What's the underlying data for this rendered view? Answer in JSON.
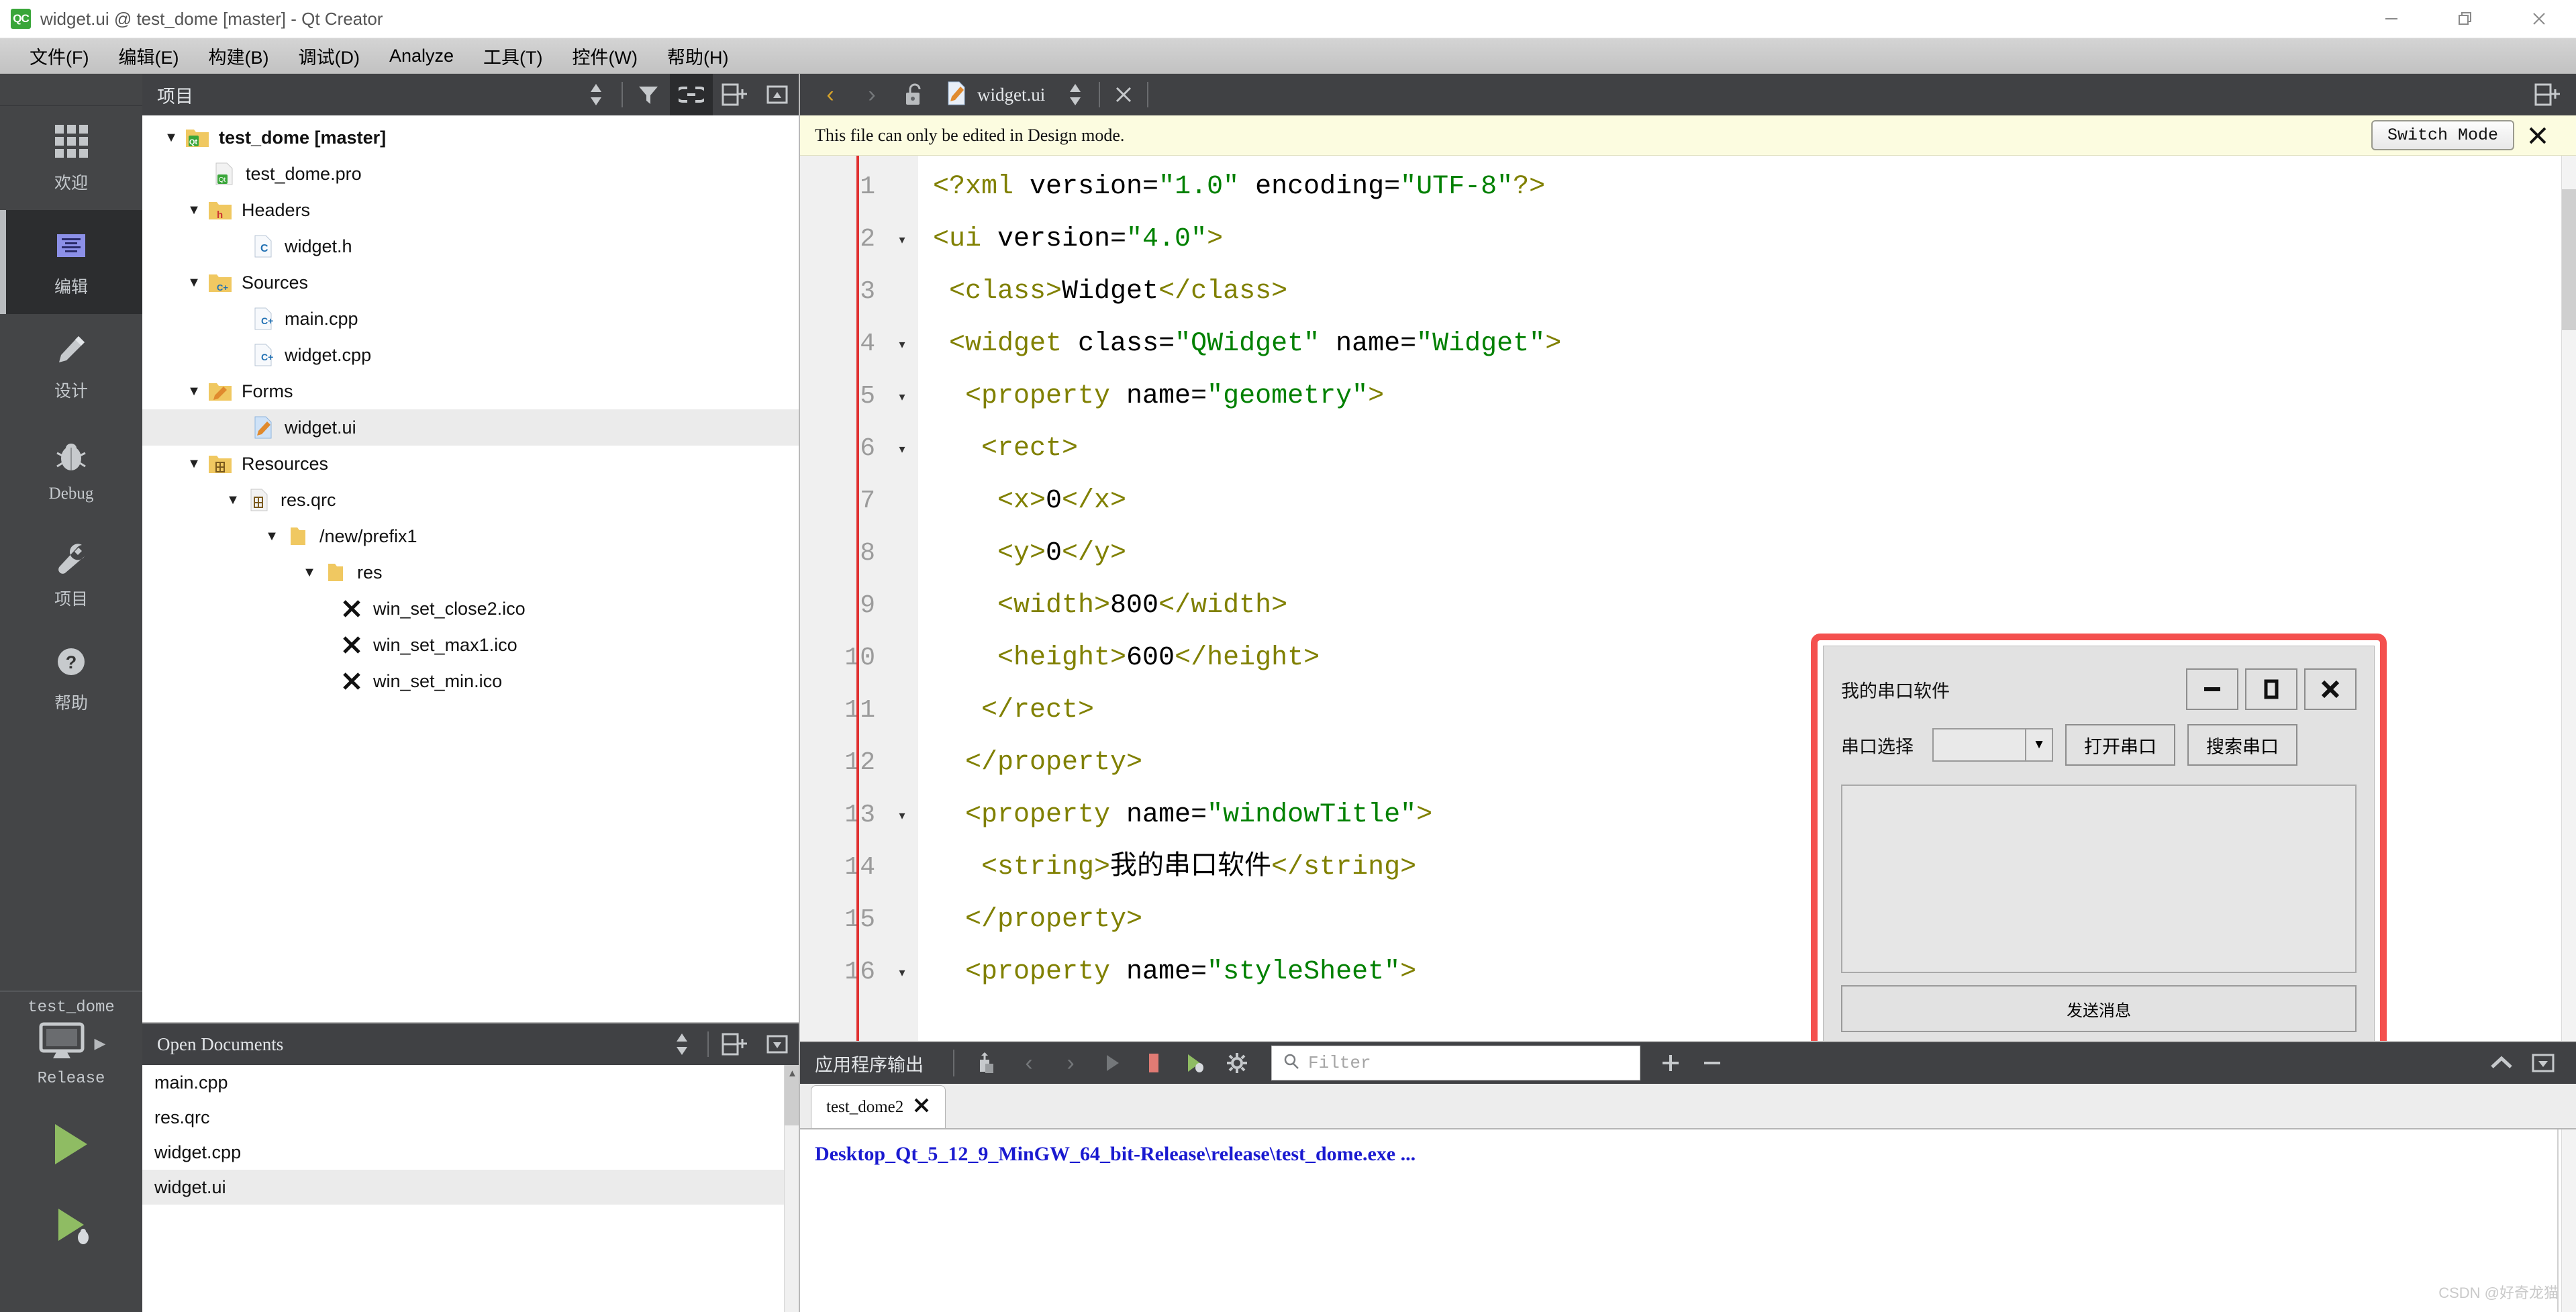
{
  "window": {
    "title": "widget.ui @ test_dome [master] - Qt Creator",
    "app_badge": "QC",
    "minimize_icon": "minimize-icon",
    "restore_icon": "restore-icon",
    "close_icon": "close-icon"
  },
  "menubar": {
    "items": [
      {
        "label": "文件(F)",
        "mnemonic": "F"
      },
      {
        "label": "编辑(E)",
        "mnemonic": "E"
      },
      {
        "label": "构建(B)",
        "mnemonic": "B"
      },
      {
        "label": "调试(D)",
        "mnemonic": "D"
      },
      {
        "label": "Analyze",
        "mnemonic": "A"
      },
      {
        "label": "工具(T)",
        "mnemonic": "T"
      },
      {
        "label": "控件(W)",
        "mnemonic": "W"
      },
      {
        "label": "帮助(H)",
        "mnemonic": "H"
      }
    ]
  },
  "modebar": {
    "items": [
      {
        "label": "欢迎",
        "icon": "grid-icon",
        "active": false
      },
      {
        "label": "编辑",
        "icon": "edit-document-icon",
        "active": true
      },
      {
        "label": "设计",
        "icon": "pencil-icon",
        "active": false
      },
      {
        "label": "Debug",
        "icon": "bug-icon",
        "active": false
      },
      {
        "label": "项目",
        "icon": "wrench-icon",
        "active": false
      },
      {
        "label": "帮助",
        "icon": "question-mark-icon",
        "active": false
      }
    ],
    "kit": {
      "project_name": "test_dome",
      "build_config": "Release",
      "target_icon": "desktop-monitor-icon",
      "run_icon": "run-play-icon",
      "debug_icon": "run-debug-icon"
    }
  },
  "project_panel": {
    "title": "项目",
    "toolbar_icons": [
      "sync-selection-icon",
      "filter-icon",
      "link-icon",
      "split-add-icon",
      "close-panel-icon"
    ],
    "tree": [
      {
        "label": "test_dome [master]",
        "indent": 0,
        "caret": "down",
        "icon": "qt-project-folder-icon",
        "bold": true,
        "selected": false
      },
      {
        "label": "test_dome.pro",
        "indent": 1,
        "caret": "none",
        "icon": "qt-pro-file-icon",
        "bold": false,
        "selected": false
      },
      {
        "label": "Headers",
        "indent": 1,
        "caret": "down",
        "icon": "headers-folder-icon",
        "bold": false,
        "selected": false
      },
      {
        "label": "widget.h",
        "indent": 2,
        "caret": "none",
        "icon": "c-header-file-icon",
        "bold": false,
        "selected": false
      },
      {
        "label": "Sources",
        "indent": 1,
        "caret": "down",
        "icon": "sources-folder-icon",
        "bold": false,
        "selected": false
      },
      {
        "label": "main.cpp",
        "indent": 2,
        "caret": "none",
        "icon": "cpp-file-icon",
        "bold": false,
        "selected": false
      },
      {
        "label": "widget.cpp",
        "indent": 2,
        "caret": "none",
        "icon": "cpp-file-icon",
        "bold": false,
        "selected": false
      },
      {
        "label": "Forms",
        "indent": 1,
        "caret": "down",
        "icon": "forms-folder-icon",
        "bold": false,
        "selected": false
      },
      {
        "label": "widget.ui",
        "indent": 2,
        "caret": "none",
        "icon": "ui-form-file-icon",
        "bold": false,
        "selected": true
      },
      {
        "label": "Resources",
        "indent": 1,
        "caret": "down",
        "icon": "resources-folder-icon",
        "bold": false,
        "selected": false
      },
      {
        "label": "res.qrc",
        "indent": 2,
        "caret": "down",
        "icon": "qrc-file-icon",
        "bold": false,
        "selected": false
      },
      {
        "label": "/new/prefix1",
        "indent": 3,
        "caret": "down",
        "icon": "plain-folder-icon",
        "bold": false,
        "selected": false
      },
      {
        "label": "res",
        "indent": 4,
        "caret": "down",
        "icon": "plain-folder-icon",
        "bold": false,
        "selected": false
      },
      {
        "label": "win_set_close2.ico",
        "indent": 5,
        "caret": "none",
        "icon": "x-mark-icon",
        "bold": false,
        "selected": false
      },
      {
        "label": "win_set_max1.ico",
        "indent": 5,
        "caret": "none",
        "icon": "x-mark-icon",
        "bold": false,
        "selected": false
      },
      {
        "label": "win_set_min.ico",
        "indent": 5,
        "caret": "none",
        "icon": "x-mark-icon",
        "bold": false,
        "selected": false
      }
    ]
  },
  "open_documents": {
    "title": "Open Documents",
    "items": [
      {
        "label": "main.cpp",
        "selected": false
      },
      {
        "label": "res.qrc",
        "selected": false
      },
      {
        "label": "widget.cpp",
        "selected": false
      },
      {
        "label": "widget.ui",
        "selected": true
      }
    ]
  },
  "editor": {
    "filename": "widget.ui",
    "back_icon": "chevron-left-icon",
    "forward_icon": "chevron-right-icon",
    "lock_icon": "unlocked-padlock-icon",
    "file_icon": "ui-form-file-icon",
    "info_message": "This file can only be edited in Design mode.",
    "switch_mode_label": "Switch Mode",
    "lines": [
      {
        "n": "1",
        "fold": false,
        "parts": [
          {
            "t": "tag",
            "s": "<?xml "
          },
          {
            "t": "attr",
            "s": "version="
          },
          {
            "t": "val",
            "s": "\"1.0\""
          },
          {
            "t": "attr",
            "s": " encoding="
          },
          {
            "t": "val",
            "s": "\"UTF-8\""
          },
          {
            "t": "tag",
            "s": "?>"
          }
        ]
      },
      {
        "n": "2",
        "fold": true,
        "parts": [
          {
            "t": "tag",
            "s": "<ui "
          },
          {
            "t": "attr",
            "s": "version="
          },
          {
            "t": "val",
            "s": "\"4.0\""
          },
          {
            "t": "tag",
            "s": ">"
          }
        ]
      },
      {
        "n": "3",
        "fold": false,
        "parts": [
          {
            "t": "tag",
            "s": " <class>"
          },
          {
            "t": "txt",
            "s": "Widget"
          },
          {
            "t": "tag",
            "s": "</class>"
          }
        ]
      },
      {
        "n": "4",
        "fold": true,
        "parts": [
          {
            "t": "tag",
            "s": " <widget "
          },
          {
            "t": "attr",
            "s": "class="
          },
          {
            "t": "val",
            "s": "\"QWidget\""
          },
          {
            "t": "attr",
            "s": " name="
          },
          {
            "t": "val",
            "s": "\"Widget\""
          },
          {
            "t": "tag",
            "s": ">"
          }
        ]
      },
      {
        "n": "5",
        "fold": true,
        "parts": [
          {
            "t": "tag",
            "s": "  <property "
          },
          {
            "t": "attr",
            "s": "name="
          },
          {
            "t": "val",
            "s": "\"geometry\""
          },
          {
            "t": "tag",
            "s": ">"
          }
        ]
      },
      {
        "n": "6",
        "fold": true,
        "parts": [
          {
            "t": "tag",
            "s": "   <rect>"
          }
        ]
      },
      {
        "n": "7",
        "fold": false,
        "parts": [
          {
            "t": "tag",
            "s": "    <x>"
          },
          {
            "t": "txt",
            "s": "0"
          },
          {
            "t": "tag",
            "s": "</x>"
          }
        ]
      },
      {
        "n": "8",
        "fold": false,
        "parts": [
          {
            "t": "tag",
            "s": "    <y>"
          },
          {
            "t": "txt",
            "s": "0"
          },
          {
            "t": "tag",
            "s": "</y>"
          }
        ]
      },
      {
        "n": "9",
        "fold": false,
        "parts": [
          {
            "t": "tag",
            "s": "    <width>"
          },
          {
            "t": "txt",
            "s": "800"
          },
          {
            "t": "tag",
            "s": "</width>"
          }
        ]
      },
      {
        "n": "10",
        "fold": false,
        "parts": [
          {
            "t": "tag",
            "s": "    <height>"
          },
          {
            "t": "txt",
            "s": "600"
          },
          {
            "t": "tag",
            "s": "</height>"
          }
        ]
      },
      {
        "n": "11",
        "fold": false,
        "parts": [
          {
            "t": "tag",
            "s": "   </rect>"
          }
        ]
      },
      {
        "n": "12",
        "fold": false,
        "parts": [
          {
            "t": "tag",
            "s": "  </property>"
          }
        ]
      },
      {
        "n": "13",
        "fold": true,
        "parts": [
          {
            "t": "tag",
            "s": "  <property "
          },
          {
            "t": "attr",
            "s": "name="
          },
          {
            "t": "val",
            "s": "\"windowTitle\""
          },
          {
            "t": "tag",
            "s": ">"
          }
        ]
      },
      {
        "n": "14",
        "fold": false,
        "parts": [
          {
            "t": "tag",
            "s": "   <string>"
          },
          {
            "t": "txt",
            "s": "我的串口软件"
          },
          {
            "t": "tag",
            "s": "</string>"
          }
        ]
      },
      {
        "n": "15",
        "fold": false,
        "parts": [
          {
            "t": "tag",
            "s": "  </property>"
          }
        ]
      },
      {
        "n": "16",
        "fold": true,
        "parts": [
          {
            "t": "tag",
            "s": "  <property "
          },
          {
            "t": "attr",
            "s": "name="
          },
          {
            "t": "val",
            "s": "\"styleSheet\""
          },
          {
            "t": "tag",
            "s": ">"
          }
        ]
      }
    ]
  },
  "overlay_widget": {
    "app_title": "我的串口软件",
    "minimize_label": "—",
    "maximize_label": "□",
    "close_label": "✕",
    "port_label": "串口选择",
    "combo_value": "",
    "open_port_label": "打开串口",
    "search_port_label": "搜索串口",
    "send_label": "发送消息",
    "highlight_color": "#f4504e"
  },
  "output_pane": {
    "title": "应用程序输出",
    "toolbar_icons": [
      "copy-output-icon",
      "prev-item-icon",
      "next-item-icon",
      "run-icon",
      "stop-icon",
      "rerun-icon",
      "settings-gear-icon"
    ],
    "filter_placeholder": "Filter",
    "search_icon": "search-icon",
    "add_icon": "plus-icon",
    "remove_icon": "minus-icon",
    "collapse_icon": "chevron-up-icon",
    "maximize_icon": "maximize-pane-icon",
    "tab": {
      "label": "test_dome2",
      "close_icon": "close-tab-icon"
    },
    "log_line": "Desktop_Qt_5_12_9_MinGW_64_bit-Release\\release\\test_dome.exe ...",
    "watermark": "CSDN @好奇龙猫"
  }
}
